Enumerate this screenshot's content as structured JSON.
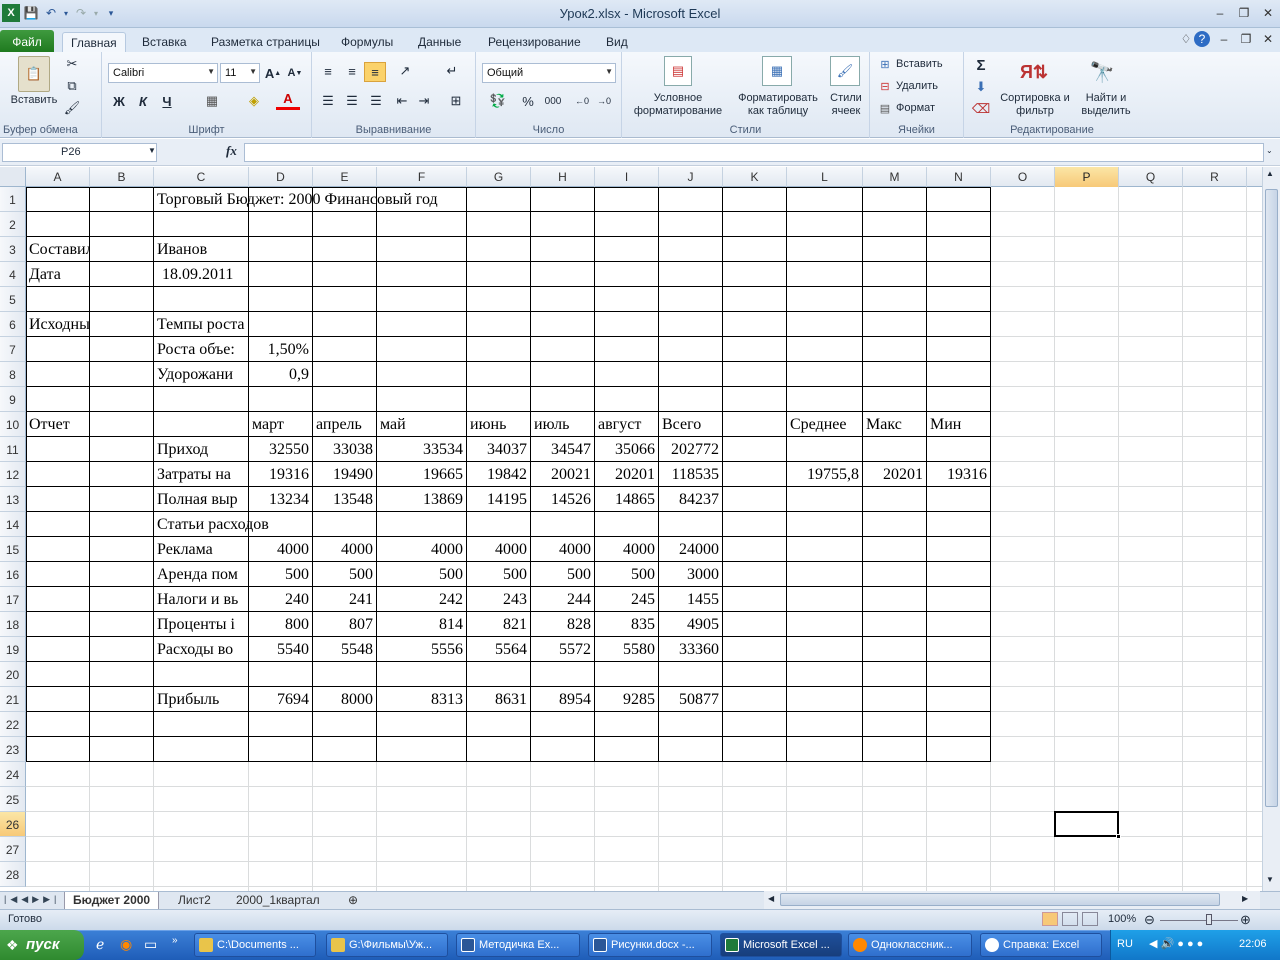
{
  "window": {
    "title": "Урок2.xlsx  -  Microsoft Excel"
  },
  "tabs": [
    "Файл",
    "Главная",
    "Вставка",
    "Разметка страницы",
    "Формулы",
    "Данные",
    "Рецензирование",
    "Вид"
  ],
  "ribbon": {
    "clipboard": {
      "label": "Буфер обмена",
      "paste": "Вставить"
    },
    "font": {
      "label": "Шрифт",
      "name": "Calibri",
      "size": "11",
      "bold": "Ж",
      "italic": "К",
      "underline": "Ч"
    },
    "alignment": {
      "label": "Выравнивание"
    },
    "number": {
      "label": "Число",
      "format": "Общий",
      "percent": "%",
      "thousands": "000"
    },
    "styles": {
      "label": "Стили",
      "conditional": "Условное форматирование",
      "format_table": "Форматировать как таблицу",
      "cell_styles": "Стили ячеек"
    },
    "cells": {
      "label": "Ячейки",
      "insert": "Вставить",
      "delete": "Удалить",
      "format": "Формат"
    },
    "editing": {
      "label": "Редактирование",
      "sort": "Сортировка и фильтр",
      "find": "Найти и выделить"
    }
  },
  "formula_bar": {
    "name_box": "P26",
    "fx": "fx",
    "value": ""
  },
  "columns": [
    "A",
    "B",
    "C",
    "D",
    "E",
    "F",
    "G",
    "H",
    "I",
    "J",
    "K",
    "L",
    "M",
    "N",
    "O",
    "P",
    "Q",
    "R"
  ],
  "selected_column": "P",
  "selected_row": "26",
  "rows": [
    "1",
    "2",
    "3",
    "4",
    "5",
    "6",
    "7",
    "8",
    "9",
    "10",
    "11",
    "12",
    "13",
    "14",
    "15",
    "16",
    "17",
    "18",
    "19",
    "20",
    "21",
    "22",
    "23",
    "24",
    "25",
    "26",
    "27",
    "28"
  ],
  "cells": {
    "C1": "Торговый Бюджет: 2000 Финансовый год",
    "A3": "Составил",
    "C3": "Иванов",
    "A4": "Дата",
    "C4": "18.09.2011",
    "A6": "Исходные данн",
    "C6": "Темпы роста",
    "C7": "Роста объе:",
    "D7": "1,50%",
    "C8": "Удорожани",
    "D8": "0,9",
    "A10": "Отчет",
    "D10": "март",
    "E10": "апрель",
    "F10": "май",
    "G10": "июнь",
    "H10": "июль",
    "I10": "август",
    "J10": "Всего",
    "L10": "Среднее",
    "M10": "Макс",
    "N10": "Мин",
    "C11": "Приход",
    "D11": "32550",
    "E11": "33038",
    "F11": "33534",
    "G11": "34037",
    "H11": "34547",
    "I11": "35066",
    "J11": "202772",
    "C12": "Затраты на",
    "D12": "19316",
    "E12": "19490",
    "F12": "19665",
    "G12": "19842",
    "H12": "20021",
    "I12": "20201",
    "J12": "118535",
    "L12": "19755,8",
    "M12": "20201",
    "N12": "19316",
    "C13": "Полная выр",
    "D13": "13234",
    "E13": "13548",
    "F13": "13869",
    "G13": "14195",
    "H13": "14526",
    "I13": "14865",
    "J13": "84237",
    "C14": "Статьи расходов",
    "C15": "Реклама",
    "D15": "4000",
    "E15": "4000",
    "F15": "4000",
    "G15": "4000",
    "H15": "4000",
    "I15": "4000",
    "J15": "24000",
    "C16": "Аренда пом",
    "D16": "500",
    "E16": "500",
    "F16": "500",
    "G16": "500",
    "H16": "500",
    "I16": "500",
    "J16": "3000",
    "C17": "Налоги и вь",
    "D17": "240",
    "E17": "241",
    "F17": "242",
    "G17": "243",
    "H17": "244",
    "I17": "245",
    "J17": "1455",
    "C18": "Проценты і",
    "D18": "800",
    "E18": "807",
    "F18": "814",
    "G18": "821",
    "H18": "828",
    "I18": "835",
    "J18": "4905",
    "C19": "Расходы во",
    "D19": "5540",
    "E19": "5548",
    "F19": "5556",
    "G19": "5564",
    "H19": "5572",
    "I19": "5580",
    "J19": "33360",
    "C21": "Прибыль",
    "D21": "7694",
    "E21": "8000",
    "F21": "8313",
    "G21": "8631",
    "H21": "8954",
    "I21": "9285",
    "J21": "50877"
  },
  "sheets": [
    "Бюджет 2000",
    "Лист2",
    "2000_1квартал"
  ],
  "status": {
    "ready": "Готово",
    "zoom": "100%"
  },
  "taskbar": {
    "start": "пуск",
    "tasks": [
      "C:\\Documents ...",
      "G:\\Фильмы\\Уж...",
      "Методичка Ех...",
      "Рисунки.docx -...",
      "Microsoft Excel ...",
      "Одноклассник...",
      "Справка: Excel"
    ],
    "lang": "RU",
    "clock": "22:06"
  }
}
